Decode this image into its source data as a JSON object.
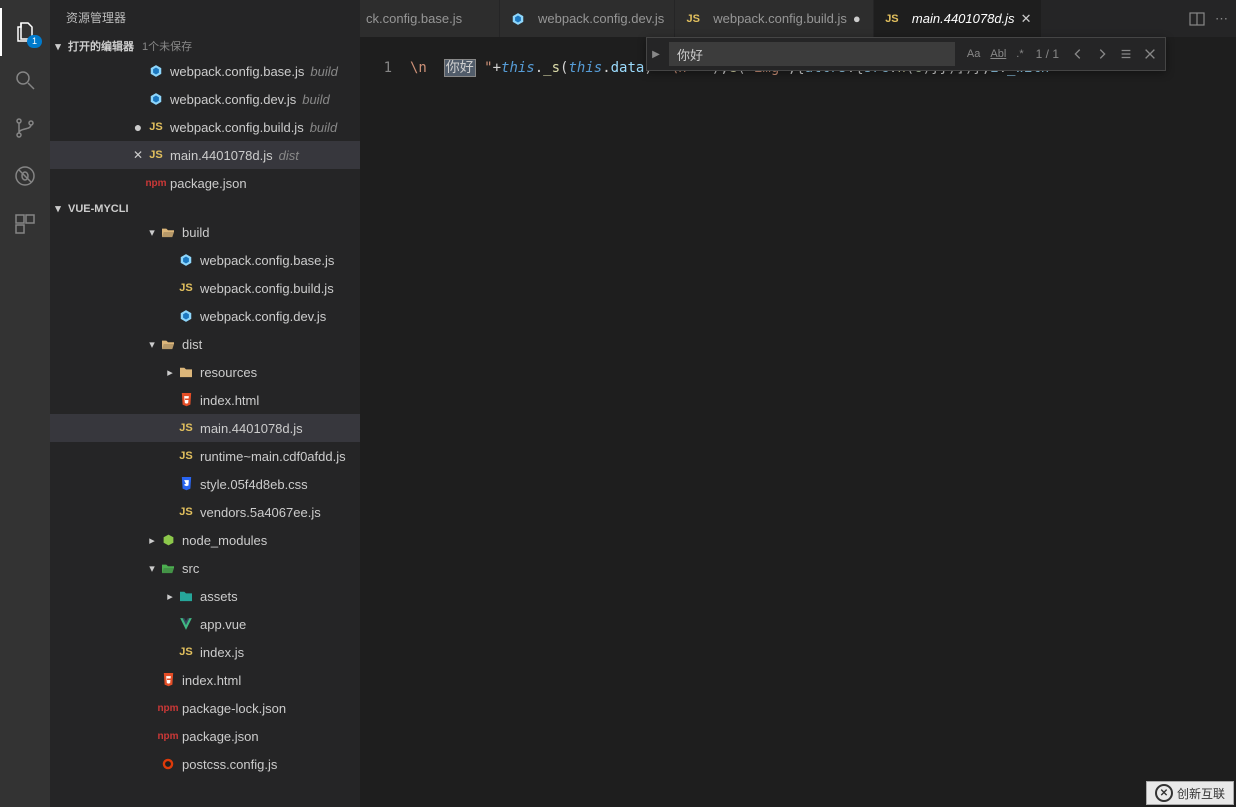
{
  "activityBar": {
    "badge": "1"
  },
  "sidebar": {
    "title": "资源管理器",
    "openEditors": {
      "label": "打开的编辑器",
      "unsaved": "1个未保存",
      "items": [
        {
          "icon": "webpack",
          "name": "webpack.config.base.js",
          "dir": "build",
          "dirty": false,
          "close": false
        },
        {
          "icon": "webpack",
          "name": "webpack.config.dev.js",
          "dir": "build",
          "dirty": false,
          "close": false
        },
        {
          "icon": "js",
          "name": "webpack.config.build.js",
          "dir": "build",
          "dirty": true,
          "close": false
        },
        {
          "icon": "js",
          "name": "main.4401078d.js",
          "dir": "dist",
          "dirty": false,
          "close": true,
          "selected": true
        }
      ]
    },
    "project": {
      "name": "VUE-MYCLI",
      "tree": [
        {
          "type": "folder-open",
          "name": "build",
          "indent": 1,
          "items": [
            {
              "icon": "webpack",
              "name": "webpack.config.base.js"
            },
            {
              "icon": "js",
              "name": "webpack.config.build.js"
            },
            {
              "icon": "webpack",
              "name": "webpack.config.dev.js"
            }
          ]
        },
        {
          "type": "folder-open",
          "name": "dist",
          "indent": 1,
          "items": [
            {
              "type": "folder-closed",
              "icon": "folder",
              "name": "resources",
              "indent": 2
            },
            {
              "icon": "html",
              "name": "index.html",
              "indent": 2
            },
            {
              "icon": "js",
              "name": "main.4401078d.js",
              "indent": 2,
              "selected": true
            },
            {
              "icon": "js",
              "name": "runtime~main.cdf0afdd.js",
              "indent": 2
            },
            {
              "icon": "css",
              "name": "style.05f4d8eb.css",
              "indent": 2
            },
            {
              "icon": "js",
              "name": "vendors.5a4067ee.js",
              "indent": 2
            }
          ]
        },
        {
          "type": "folder-closed",
          "icon": "node",
          "name": "node_modules",
          "indent": 1
        },
        {
          "type": "folder-open",
          "icon": "folder-src",
          "name": "src",
          "indent": 1,
          "items": [
            {
              "type": "folder-closed",
              "icon": "folder-img",
              "name": "assets",
              "indent": 2
            },
            {
              "icon": "vue",
              "name": "app.vue",
              "indent": 2
            },
            {
              "icon": "js",
              "name": "index.js",
              "indent": 2
            }
          ]
        },
        {
          "icon": "html",
          "name": "index.html",
          "indent": 1
        },
        {
          "icon": "npm",
          "name": "package-lock.json",
          "indent": 1
        },
        {
          "icon": "npm",
          "name": "package.json",
          "indent": 1
        },
        {
          "icon": "postcss",
          "name": "postcss.config.js",
          "indent": 1
        }
      ],
      "rootExtra": {
        "icon": "npm",
        "name": "package.json"
      }
    }
  },
  "tabs": [
    {
      "icon": "",
      "label": "ck.config.base.js",
      "partial": true
    },
    {
      "icon": "webpack",
      "label": "webpack.config.dev.js"
    },
    {
      "icon": "js",
      "label": "webpack.config.build.js",
      "dirty": true
    },
    {
      "icon": "js",
      "label": "main.4401078d.js",
      "active": true,
      "italic": true,
      "close": true
    }
  ],
  "find": {
    "value": "你好",
    "count": "1 / 1",
    "options": {
      "case": "Aa",
      "word": "Abl",
      "regex": ".*"
    }
  },
  "editor": {
    "lineNumber": "1",
    "highlightWord": "你好",
    "codeSegments": {
      "s1": "\\n  ",
      "s2": " \"",
      "plus1": "+",
      "this1": "this",
      "dot1": ".",
      "fn_s": "_s",
      "op1": "(",
      "this2": "this",
      "dot2": ".",
      "data": "data",
      "cp1": ")",
      "plus2": "+",
      "s3": "\"\\n  \"",
      "cp2": ")",
      "comma1": ",",
      "fn_e": "e",
      "op2": "(",
      "s4": "\"img\"",
      "comma2": ",",
      "ob1": "{",
      "attrs": "attrs",
      "colon1": ":",
      "ob2": "{",
      "src": "src",
      "colon2": ":",
      "fn_n": "n",
      "op3": "(",
      "num6": "6",
      "cp3": ")",
      "cb1": "}",
      "cb2": "}",
      "cp4": ")",
      "cb3": "]",
      "cp5": ")",
      "cb4": "}",
      "semi": ";",
      "ivar": "i",
      "dot3": ".",
      "with": "_with"
    }
  },
  "watermark": {
    "text": "创新互联"
  }
}
